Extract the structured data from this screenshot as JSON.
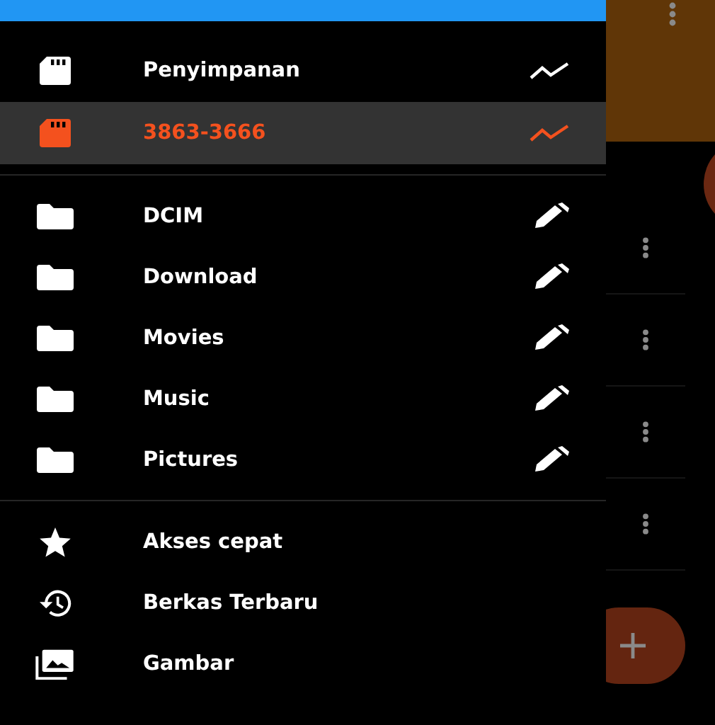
{
  "storage": [
    {
      "label": "Penyimpanan",
      "selected": false
    },
    {
      "label": "3863-3666",
      "selected": true
    }
  ],
  "folders": [
    {
      "label": "DCIM"
    },
    {
      "label": "Download"
    },
    {
      "label": "Movies"
    },
    {
      "label": "Music"
    },
    {
      "label": "Pictures"
    }
  ],
  "shortcuts": [
    {
      "label": "Akses cepat",
      "kind": "star"
    },
    {
      "label": "Berkas Terbaru",
      "kind": "history"
    },
    {
      "label": "Gambar",
      "kind": "images"
    }
  ]
}
